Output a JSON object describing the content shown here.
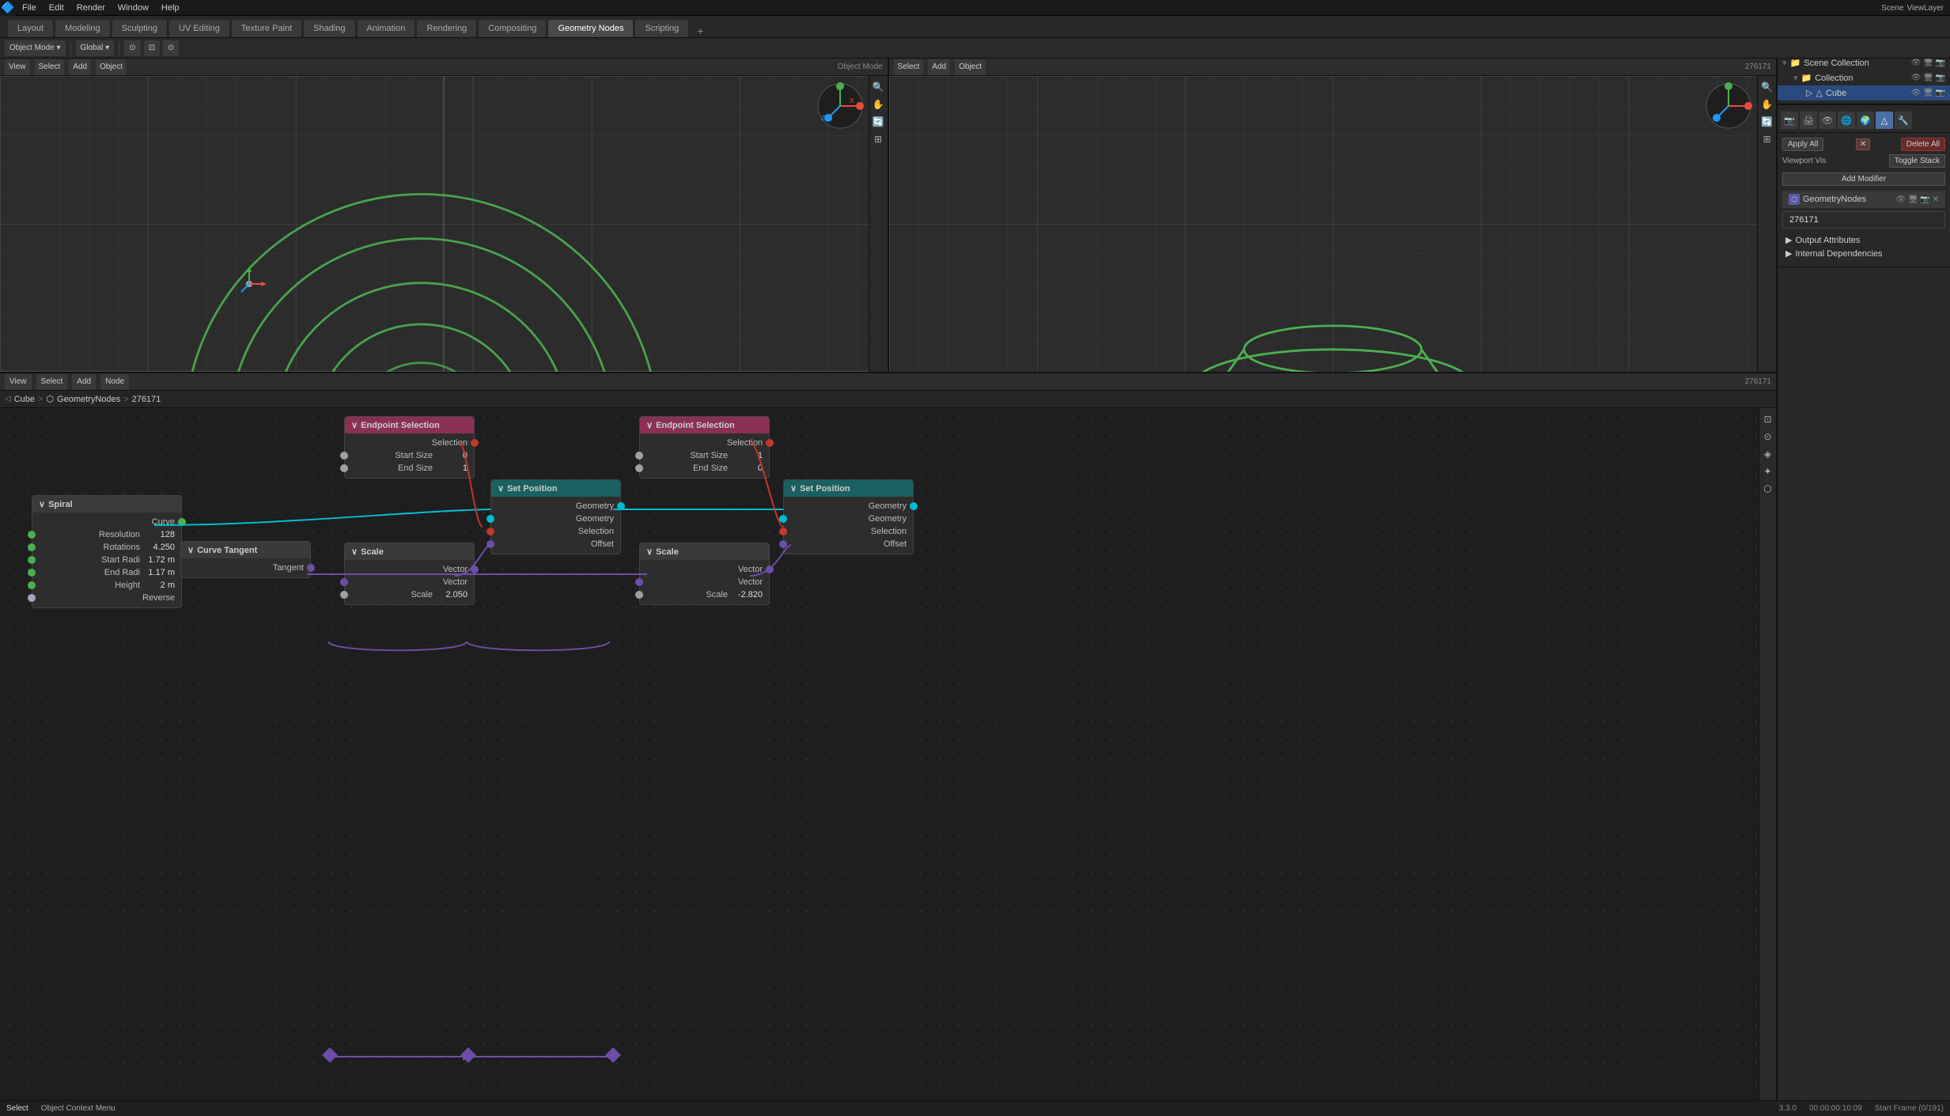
{
  "app": {
    "title": "Blender",
    "version": "3.3.0",
    "scene": "Scene",
    "viewlayer": "ViewLayer"
  },
  "menu": {
    "items": [
      "File",
      "Edit",
      "Render",
      "Window",
      "Help"
    ]
  },
  "workspaceTabs": [
    {
      "label": "Layout",
      "active": false
    },
    {
      "label": "Modeling",
      "active": false
    },
    {
      "label": "Sculpting",
      "active": false
    },
    {
      "label": "UV Editing",
      "active": false
    },
    {
      "label": "Texture Paint",
      "active": false
    },
    {
      "label": "Shading",
      "active": false
    },
    {
      "label": "Animation",
      "active": false
    },
    {
      "label": "Rendering",
      "active": false
    },
    {
      "label": "Compositing",
      "active": false
    },
    {
      "label": "Geometry Nodes",
      "active": true
    },
    {
      "label": "Scripting",
      "active": false
    }
  ],
  "viewport": {
    "leftHeader": {
      "view": "View",
      "select": "Select",
      "add": "Add",
      "object": "Object"
    },
    "rightHeader": {
      "select": "Select",
      "add": "Add",
      "object": "Object"
    },
    "frameNumber": "276171"
  },
  "nodeEditor": {
    "header": {
      "view": "View",
      "select": "Select",
      "add": "Add",
      "node": "Node"
    },
    "frameNumber": "276171",
    "breadcrumb": {
      "cube": "Cube",
      "sep1": ">",
      "geometryNodes": "GeometryNodes",
      "sep2": ">",
      "nodeTree": "276171"
    }
  },
  "nodes": {
    "spiral": {
      "title": "Spiral",
      "curve_label": "Curve",
      "resolution_label": "Resolution",
      "resolution_value": "128",
      "rotations_label": "Rotations",
      "rotations_value": "4.250",
      "startRadi_label": "Start Radi",
      "startRadi_value": "1.72 m",
      "endRadi_label": "End Radi",
      "endRadi_value": "1.17 m",
      "height_label": "Height",
      "height_value": "2 m",
      "reverse_label": "Reverse"
    },
    "endpointSelection1": {
      "title": "Endpoint Selection",
      "selection_label": "Selection",
      "startSize_label": "Start Size",
      "startSize_value": "0",
      "endSize_label": "End Size",
      "endSize_value": "1"
    },
    "endpointSelection2": {
      "title": "Endpoint Selection",
      "selection_label": "Selection",
      "startSize_label": "Start Size",
      "startSize_value": "1",
      "endSize_label": "End Size",
      "endSize_value": "0"
    },
    "setPosition1": {
      "title": "Set Position",
      "geometry_label": "Geometry",
      "geometry_out_label": "Geometry",
      "selection_label": "Selection",
      "offset_label": "Offset"
    },
    "setPosition2": {
      "title": "Set Position",
      "geometry_label": "Geometry",
      "geometry_out_label": "Geometry",
      "selection_label": "Selection",
      "offset_label": "Offset"
    },
    "scale1": {
      "title": "Scale",
      "vector_in": "Vector",
      "vector_out": "Vector",
      "scale_label": "Scale",
      "scale_value": "2.050"
    },
    "scale2": {
      "title": "Scale",
      "vector_in": "Vector",
      "vector_out": "Vector",
      "scale_label": "Scale",
      "scale_value": "-2.820"
    },
    "curveTangent": {
      "title": "Curve Tangent",
      "tangent_label": "Tangent"
    }
  },
  "rightPanel": {
    "sceneCollection": "Scene Collection",
    "collection": "Collection",
    "cube": "Cube",
    "modifiers": {
      "applyAll": "Apply All",
      "delete": "Delete All",
      "viewportVis": "Viewport Vis",
      "toggleStack": "Toggle Stack",
      "addModifier": "Add Modifier",
      "geometryNodesName": "GeometryNodes",
      "nodeTreeName": "276171",
      "outputAttributes": "Output Attributes",
      "internalDependencies": "Internal Dependencies"
    }
  },
  "statusBar": {
    "select": "Select",
    "objectContextMenu": "Object Context Menu",
    "version": "3.3.0",
    "time": "00:00:00:10:09",
    "startFrame": "Start Frame (0/191)"
  }
}
